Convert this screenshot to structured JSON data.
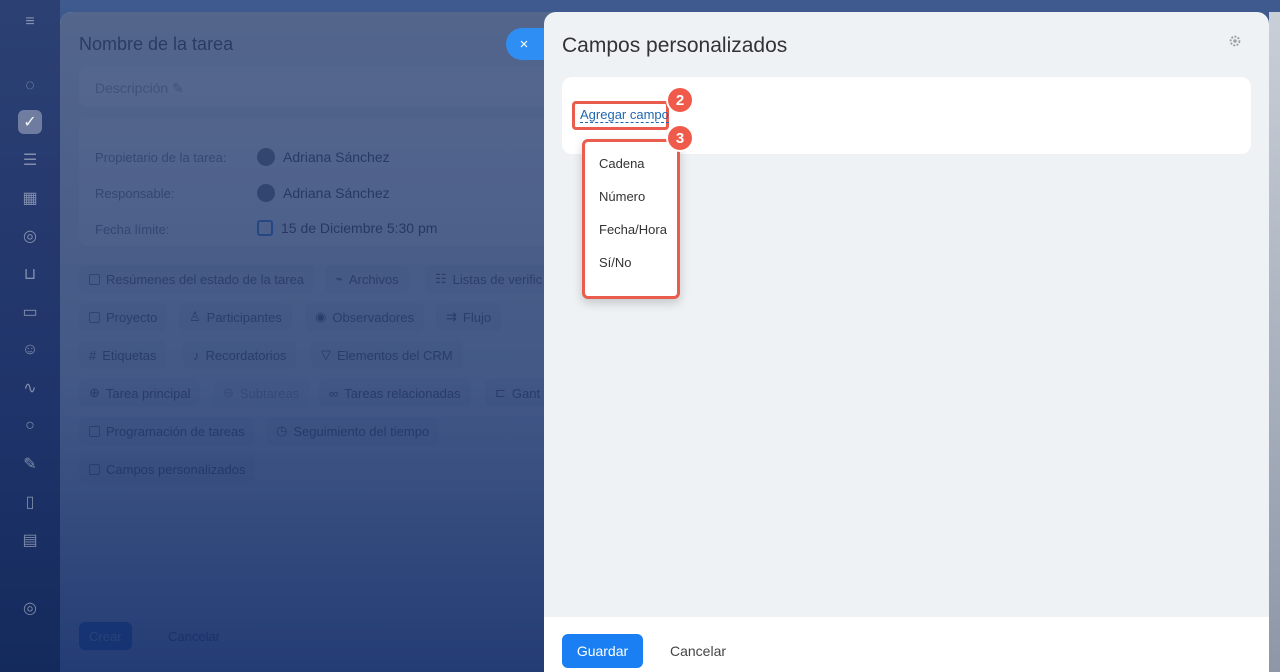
{
  "top_zoom": "100%",
  "task": {
    "title": "Nombre de la tarea",
    "description_placeholder": "Descripción",
    "owner_label": "Propietario de la tarea:",
    "owner_value": "Adriana Sánchez",
    "responsible_label": "Responsable:",
    "responsible_value": "Adriana Sánchez",
    "deadline_label": "Fecha límite:",
    "deadline_value": "15 de Diciembre 5:30 pm",
    "chips": [
      "Resúmenes del estado de la tarea",
      "Archivos",
      "Listas de verific",
      "Proyecto",
      "Participantes",
      "Observadores",
      "Flujo",
      "Etiquetas",
      "Recordatorios",
      "Elementos del CRM",
      "Tarea principal",
      "Subtareas",
      "Tareas relacionadas",
      "Gant",
      "Programación de tareas",
      "Seguimiento del tiempo",
      "Campos personalizados"
    ],
    "footer_primary": "Crear",
    "footer_secondary": "Cancelar"
  },
  "close_button": "×",
  "panel": {
    "title": "Campos personalizados",
    "add_field_link": "Agregar campo",
    "menu_items": [
      "Cadena",
      "Número",
      "Fecha/Hora",
      "Sí/No"
    ],
    "badge_step_2": "2",
    "badge_step_3": "3",
    "save_label": "Guardar",
    "cancel_label": "Cancelar"
  }
}
